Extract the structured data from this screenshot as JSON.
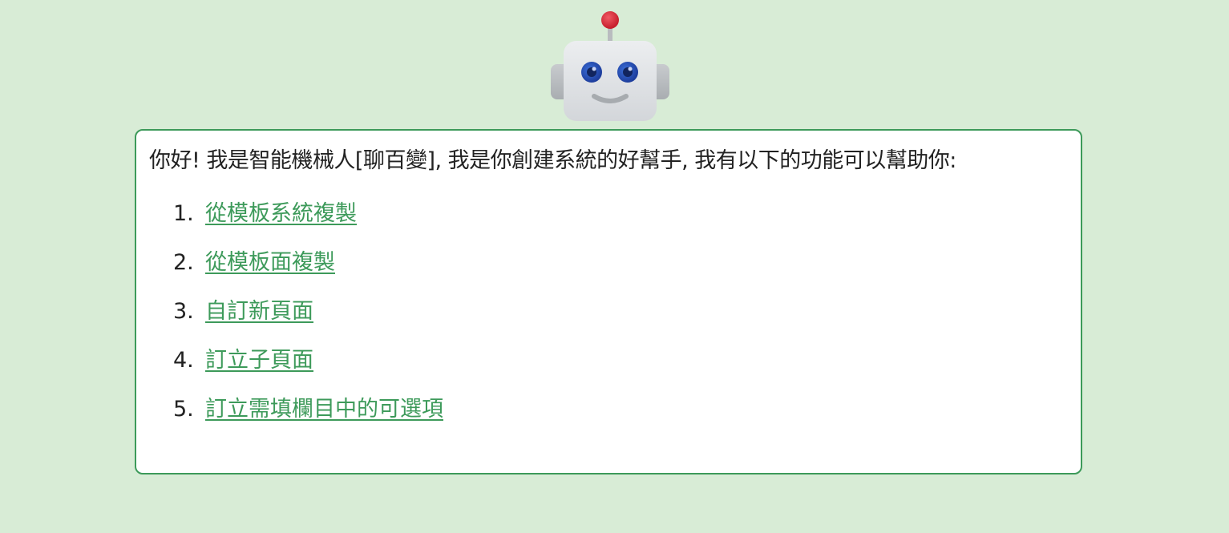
{
  "intro": "你好! 我是智能機械人[聊百變], 我是你創建系統的好幫手, 我有以下的功能可以幫助你:",
  "options": [
    {
      "number": "1.",
      "label": "從模板系統複製"
    },
    {
      "number": "2.",
      "label": "從模板面複製"
    },
    {
      "number": "3.",
      "label": "自訂新頁面"
    },
    {
      "number": "4.",
      "label": "訂立子頁面"
    },
    {
      "number": "5.",
      "label": "訂立需填欄目中的可選項"
    }
  ],
  "colors": {
    "background": "#d8ecd6",
    "accent": "#3d9a5a",
    "card": "#ffffff",
    "text": "#222222"
  },
  "icons": {
    "avatar": "robot-icon"
  }
}
